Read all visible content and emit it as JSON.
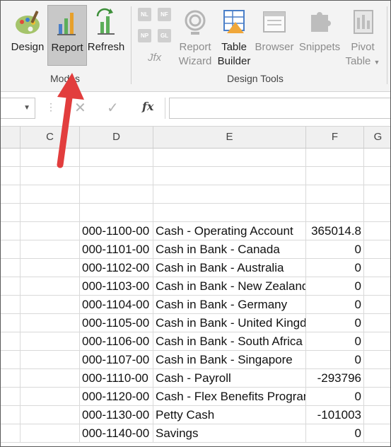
{
  "ribbon": {
    "modes_group": {
      "label": "Modes",
      "buttons": [
        {
          "name": "design",
          "label": "Design"
        },
        {
          "name": "report",
          "label": "Report",
          "selected": true
        },
        {
          "name": "refresh",
          "label": "Refresh"
        }
      ]
    },
    "small_buttons": [
      "NL",
      "NF",
      "NP",
      "GL"
    ],
    "jfx_label": "Jfx",
    "design_tools_group": {
      "label": "Design Tools",
      "buttons": [
        {
          "name": "report-wizard",
          "line1": "Report",
          "line2": "Wizard",
          "enabled": false
        },
        {
          "name": "table-builder",
          "line1": "Table",
          "line2": "Builder",
          "enabled": true
        },
        {
          "name": "browser",
          "line1": "Browser",
          "line2": "",
          "enabled": false
        },
        {
          "name": "snippets",
          "line1": "Snippets",
          "line2": "",
          "enabled": false
        },
        {
          "name": "pivot-table",
          "line1": "Pivot",
          "line2": "Table",
          "enabled": false
        }
      ]
    }
  },
  "formula_bar": {
    "fx_label": "fx",
    "cancel_glyph": "✕",
    "enter_glyph": "✓"
  },
  "columns": [
    "C",
    "D",
    "E",
    "F",
    "G"
  ],
  "rows": [
    {
      "account": "",
      "description": "",
      "amount": ""
    },
    {
      "account": "",
      "description": "",
      "amount": ""
    },
    {
      "account": "",
      "description": "",
      "amount": ""
    },
    {
      "account": "",
      "description": "",
      "amount": ""
    },
    {
      "account": "000-1100-00",
      "description": "Cash - Operating Account",
      "amount": "365014.8"
    },
    {
      "account": "000-1101-00",
      "description": "Cash in Bank - Canada",
      "amount": "0"
    },
    {
      "account": "000-1102-00",
      "description": "Cash in Bank - Australia",
      "amount": "0"
    },
    {
      "account": "000-1103-00",
      "description": "Cash in Bank - New Zealand",
      "amount": "0"
    },
    {
      "account": "000-1104-00",
      "description": "Cash in Bank - Germany",
      "amount": "0"
    },
    {
      "account": "000-1105-00",
      "description": "Cash in Bank - United Kingdom",
      "amount": "0"
    },
    {
      "account": "000-1106-00",
      "description": "Cash in Bank - South Africa",
      "amount": "0"
    },
    {
      "account": "000-1107-00",
      "description": "Cash in Bank - Singapore",
      "amount": "0"
    },
    {
      "account": "000-1110-00",
      "description": "Cash - Payroll",
      "amount": "-293796"
    },
    {
      "account": "000-1120-00",
      "description": "Cash - Flex Benefits Program",
      "amount": "0"
    },
    {
      "account": "000-1130-00",
      "description": "Petty Cash",
      "amount": "-101003"
    },
    {
      "account": "000-1140-00",
      "description": "Savings",
      "amount": "0"
    }
  ],
  "colors": {
    "arrow": "#e23d3d",
    "selected_button": "#c8c8c8",
    "ribbon_bg": "#f3f3f3"
  }
}
